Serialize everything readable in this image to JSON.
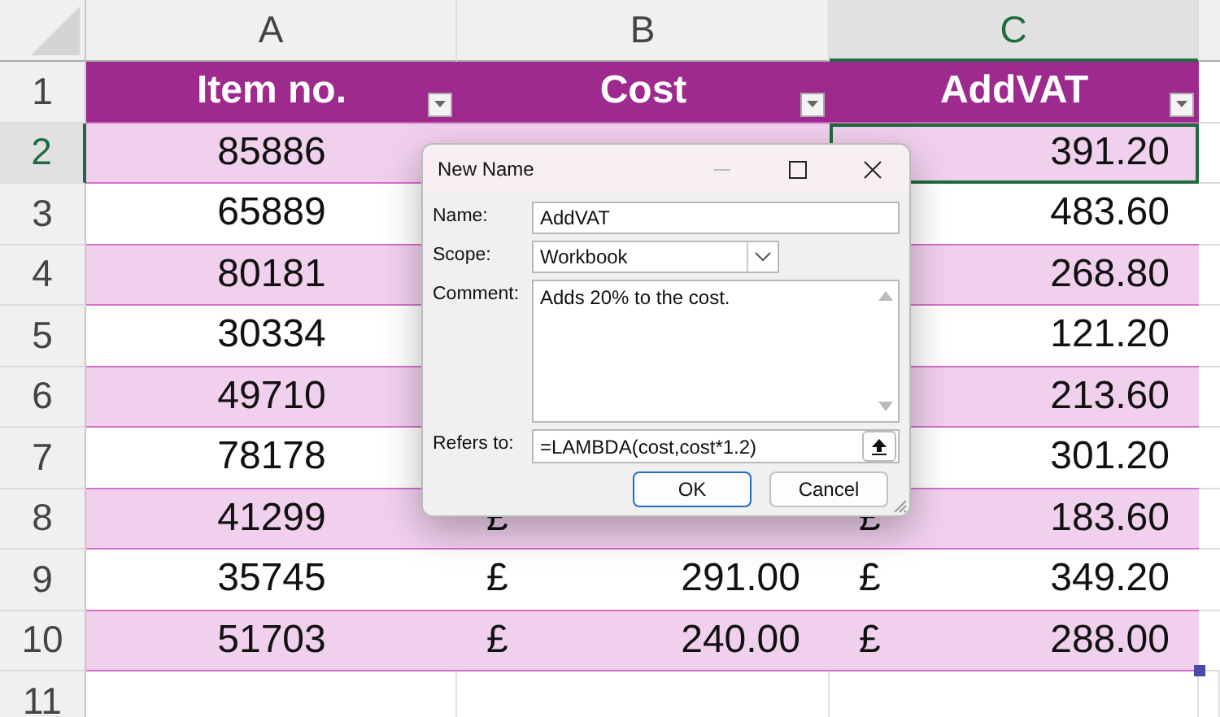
{
  "sheet": {
    "columns": [
      {
        "label": "A",
        "selected": false
      },
      {
        "label": "B",
        "selected": false
      },
      {
        "label": "C",
        "selected": true
      }
    ],
    "header_row": {
      "number": "1",
      "cells": [
        "Item no.",
        "Cost",
        "AddVAT"
      ]
    },
    "rows": [
      {
        "number": "2",
        "selected": true,
        "item": "85886",
        "vat": "391.20"
      },
      {
        "number": "3",
        "selected": false,
        "item": "65889",
        "vat": "483.60"
      },
      {
        "number": "4",
        "selected": false,
        "item": "80181",
        "vat": "268.80"
      },
      {
        "number": "5",
        "selected": false,
        "item": "30334",
        "vat": "121.20"
      },
      {
        "number": "6",
        "selected": false,
        "item": "49710",
        "vat": "213.60"
      },
      {
        "number": "7",
        "selected": false,
        "item": "78178",
        "vat": "301.20"
      },
      {
        "number": "8",
        "selected": false,
        "item": "41299",
        "cost_currency": "£",
        "vat_currency": "£",
        "vat": "183.60"
      },
      {
        "number": "9",
        "selected": false,
        "item": "35745",
        "cost_currency": "£",
        "cost": "291.00",
        "vat_currency": "£",
        "vat": "349.20"
      },
      {
        "number": "10",
        "selected": false,
        "item": "51703",
        "cost_currency": "£",
        "cost": "240.00",
        "vat_currency": "£",
        "vat": "288.00"
      }
    ],
    "empty_row": {
      "number": "11"
    }
  },
  "dialog": {
    "title": "New Name",
    "fields": [
      {
        "kind": "text",
        "label": "Name:",
        "value": "AddVAT"
      },
      {
        "kind": "dropdown",
        "label": "Scope:",
        "value": "Workbook"
      },
      {
        "kind": "textarea",
        "label": "Comment:",
        "value": "Adds 20% to the cost."
      },
      {
        "kind": "reference",
        "label": "Refers to:",
        "value": "=LAMBDA(cost,cost*1.2)"
      }
    ],
    "buttons": [
      {
        "label": "OK",
        "default": true
      },
      {
        "label": "Cancel",
        "default": false
      }
    ]
  }
}
